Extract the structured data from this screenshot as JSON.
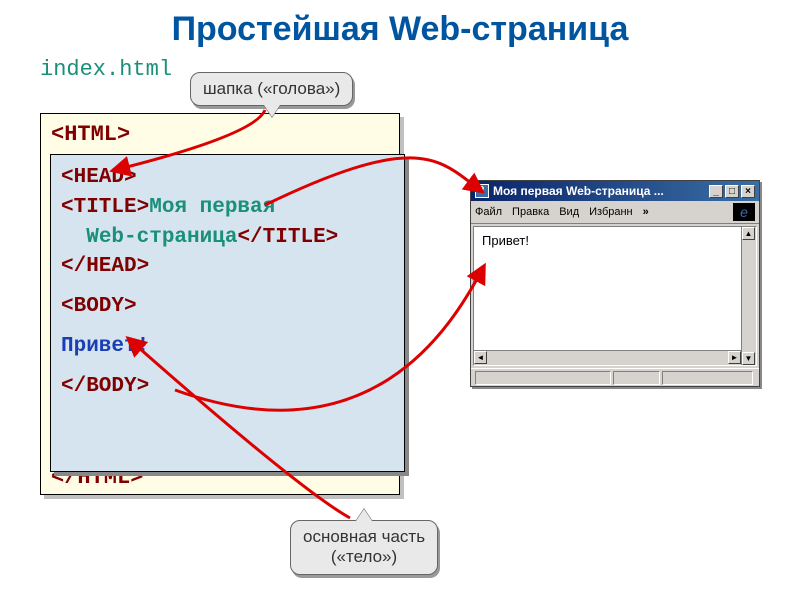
{
  "title": "Простейшая Web-страница",
  "filename": "index.html",
  "code": {
    "html_open": "<HTML>",
    "html_close": "</HTML>",
    "head_open": "<HEAD>",
    "title_open": "<TITLE>",
    "title_text_line1": "Моя первая",
    "title_text_line2": "Web-страница",
    "title_close": "</TITLE>",
    "head_close": "</HEAD>",
    "body_open": "<BODY>",
    "body_text": "Привет!",
    "body_close": "</BODY>"
  },
  "callouts": {
    "head": "шапка («голова»)",
    "body_line1": "основная часть",
    "body_line2": "(«тело»)"
  },
  "browser": {
    "title": "Моя первая Web-страница ...",
    "menu": {
      "file": "Файл",
      "edit": "Правка",
      "view": "Вид",
      "fav": "Избранн",
      "more": "»"
    },
    "content": "Привет!",
    "btn_min": "_",
    "btn_max": "□",
    "btn_close": "×"
  }
}
